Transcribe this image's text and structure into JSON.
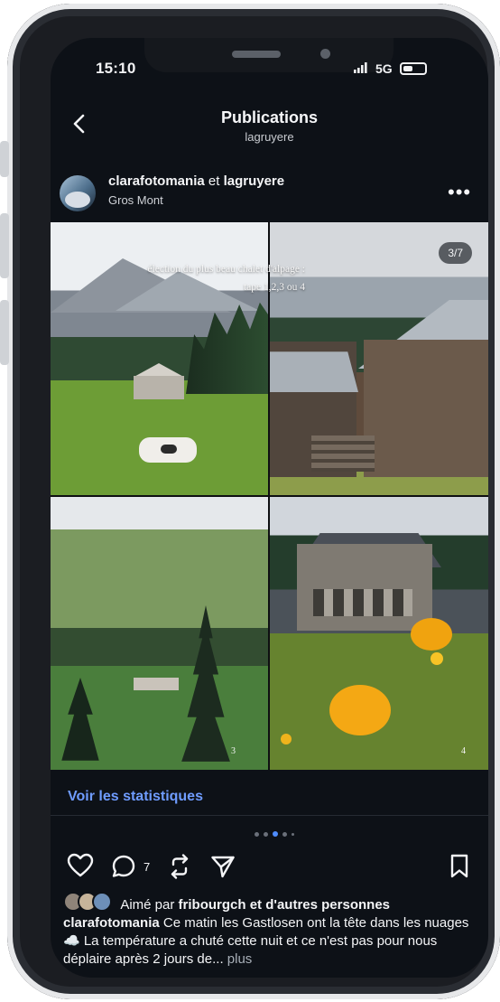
{
  "status": {
    "time": "15:10",
    "network": "5G"
  },
  "header": {
    "title": "Publications",
    "subtitle": "lagruyere"
  },
  "post": {
    "user_primary": "clarafotomania",
    "user_joiner": "et",
    "user_secondary": "lagruyere",
    "location": "Gros Mont",
    "counter": "3/7",
    "overlay_text": "élection du plus beau chalet d'alpage :",
    "overlay_text_line2": "tape 1,2,3 ou 4",
    "page_numbers": [
      "3",
      "4"
    ],
    "stats_link": "Voir les statistiques",
    "comment_count": "7",
    "likes_prefix": "Aimé par",
    "likes_user": "fribourgch",
    "likes_suffix": "et d'autres personnes",
    "caption_user": "clarafotomania",
    "caption_text": "Ce matin les Gastlosen ont la tête dans les nuages ☁️ La température a chuté cette nuit et ce n'est pas pour nous déplaire après 2 jours de...",
    "caption_more": "plus"
  },
  "icons": {
    "back": "chevron-left-icon",
    "more": "more-horizontal-icon",
    "like": "heart-icon",
    "comment": "comment-icon",
    "repost": "repost-icon",
    "share": "send-icon",
    "save": "bookmark-icon",
    "battery": "battery-icon",
    "signal": "signal-icon"
  },
  "colors": {
    "screen_bg": "#0d1117",
    "link": "#6f9cff",
    "active_dot": "#4f8dff"
  }
}
